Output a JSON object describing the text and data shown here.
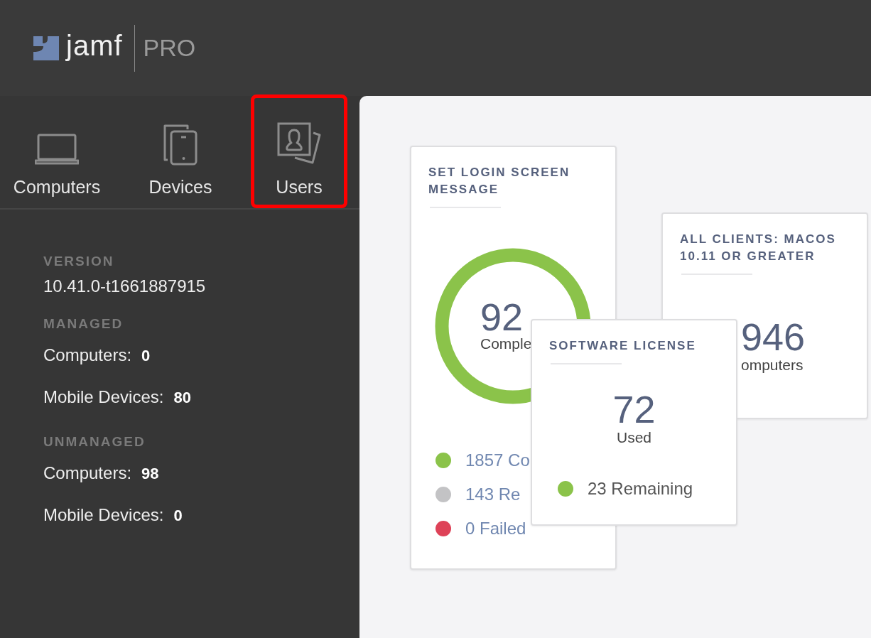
{
  "header": {
    "logo_text": "jamf",
    "product": "PRO"
  },
  "nav": [
    {
      "kind": "laptop",
      "label": "Computers",
      "highlighted": false
    },
    {
      "kind": "devices",
      "label": "Devices",
      "highlighted": false
    },
    {
      "kind": "users",
      "label": "Users",
      "highlighted": true
    }
  ],
  "info": [
    {
      "kind": "heading",
      "text": "VERSION"
    },
    {
      "kind": "value",
      "text": "10.41.0-t1661887915"
    },
    {
      "kind": "heading",
      "text": "MANAGED"
    },
    {
      "kind": "stat",
      "label": "Computers:",
      "value": "0"
    },
    {
      "kind": "stat",
      "label": "Mobile Devices:",
      "value": "80"
    },
    {
      "kind": "heading",
      "text": "UNMANAGED"
    },
    {
      "kind": "stat",
      "label": "Computers:",
      "value": "98"
    },
    {
      "kind": "stat",
      "label": "Mobile Devices:",
      "value": "0"
    }
  ],
  "cards": [
    {
      "kind": "progress",
      "title": "SET LOGIN SCREEN MESSAGE",
      "value": "92",
      "caption": "Comple",
      "legend": [
        {
          "text": "1857 Co",
          "color": "#8bc34a"
        },
        {
          "text": "143 Re",
          "color": "#c3c3c5"
        },
        {
          "text": "0 Failed",
          "color": "#de4258"
        }
      ]
    },
    {
      "kind": "count",
      "title": "ALL CLIENTS: MACOS 10.11 OR GREATER",
      "value": "946",
      "caption": "omputers"
    },
    {
      "kind": "license",
      "title": "SOFTWARE LICENSE",
      "value": "72",
      "caption": "Used",
      "legend": [
        {
          "text": "23 Remaining",
          "color": "#8bc34a"
        }
      ]
    }
  ]
}
